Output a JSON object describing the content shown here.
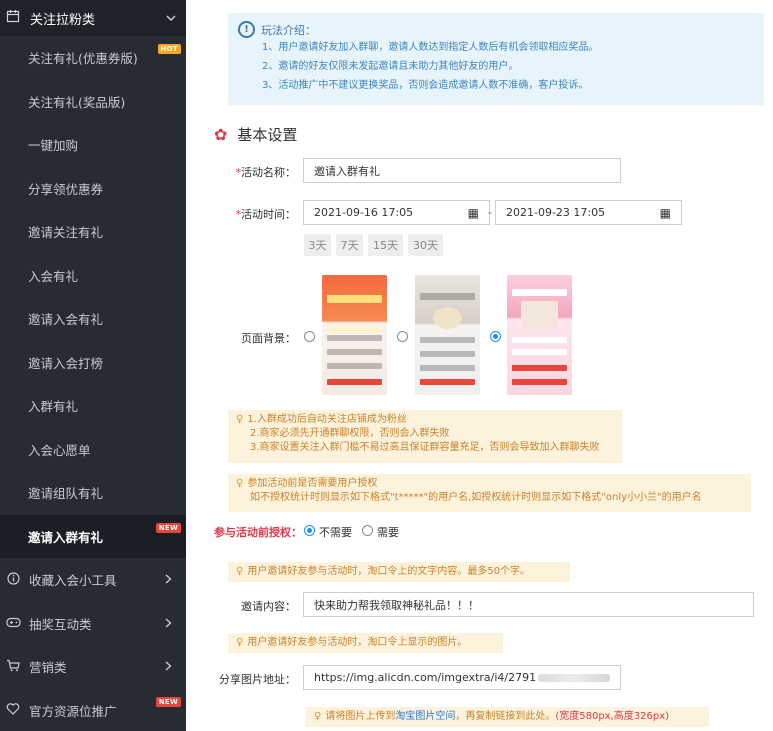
{
  "sidebar": {
    "header": {
      "label": "关注拉粉类"
    },
    "items": [
      {
        "label": "关注有礼(优惠券版)",
        "badge": "HOT"
      },
      {
        "label": "关注有礼(奖品版)",
        "badge": ""
      },
      {
        "label": "一键加购",
        "badge": ""
      },
      {
        "label": "分享领优惠券",
        "badge": ""
      },
      {
        "label": "邀请关注有礼",
        "badge": ""
      },
      {
        "label": "入会有礼",
        "badge": ""
      },
      {
        "label": "邀请入会有礼",
        "badge": ""
      },
      {
        "label": "邀请入会打榜",
        "badge": ""
      },
      {
        "label": "入群有礼",
        "badge": ""
      },
      {
        "label": "入会心愿单",
        "badge": ""
      },
      {
        "label": "邀请组队有礼",
        "badge": ""
      },
      {
        "label": "邀请入群有礼",
        "badge": "NEW"
      }
    ],
    "groups": [
      {
        "label": "收藏入会小工具",
        "icon": "info-icon",
        "badge": ""
      },
      {
        "label": "抽奖互动类",
        "icon": "game-icon",
        "badge": ""
      },
      {
        "label": "营销类",
        "icon": "cart-icon",
        "badge": ""
      },
      {
        "label": "官方资源位推广",
        "icon": "heart-icon",
        "badge": "NEW"
      }
    ]
  },
  "intro": {
    "title": "玩法介绍：",
    "lines": [
      "1、用户邀请好友加入群聊，邀请人数达到指定人数后有机会领取相应奖品。",
      "2、邀请的好友仅限未发起邀请且未助力其他好友的用户。",
      "3、活动推广中不建议更换奖品，否则会造成邀请人数不准确，客户投诉。"
    ]
  },
  "section_title": "基本设置",
  "form": {
    "name_label": "活动名称：",
    "name_value": "邀请入群有礼",
    "time_label": "活动时间：",
    "start_time": "2021-09-16 17:05",
    "end_time": "2021-09-23 17:05",
    "range_sep": "-",
    "quick": [
      "3天",
      "7天",
      "15天",
      "30天"
    ],
    "bg_label": "页面背景：",
    "bg_selected": 3,
    "tip1": [
      "1.入群成功后自动关注店铺成为粉丝",
      "2.商家必须先开通群聊权限，否则会入群失败",
      "3.商家设置关注入群门槛不易过高且保证群容量充足，否则会导致加入群聊失败"
    ],
    "tip2": [
      "参加活动前是否需要用户授权",
      "如不授权统计时则显示如下格式\"t*****\"的用户名,如授权统计时则显示如下格式\"only小小兰\"的用户名"
    ],
    "auth_label": "参与活动前授权：",
    "auth_options": [
      "不需要",
      "需要"
    ],
    "auth_selected": "不需要",
    "tip3": "用户邀请好友参与活动时，淘口令上的文字内容。最多50个字。",
    "invite_label": "邀请内容：",
    "invite_value": "快来助力帮我领取神秘礼品！！！",
    "tip4": "用户邀请好友参与活动时，淘口令上显示的图片。",
    "share_label": "分享图片地址：",
    "share_value": "https://img.alicdn.com/imgextra/i4/2791",
    "tip5_prefix": "请将图片上传到",
    "tip5_link": "淘宝图片空间",
    "tip5_mid": "，再复制链接到此处。",
    "tip5_size": "(宽度580px,高度326px)"
  },
  "colors": {
    "sidebar_bg": "#272b33",
    "accent_red": "#e0394a",
    "info_blue": "#3a8bc4",
    "tip_bg": "#fdf3dc"
  }
}
